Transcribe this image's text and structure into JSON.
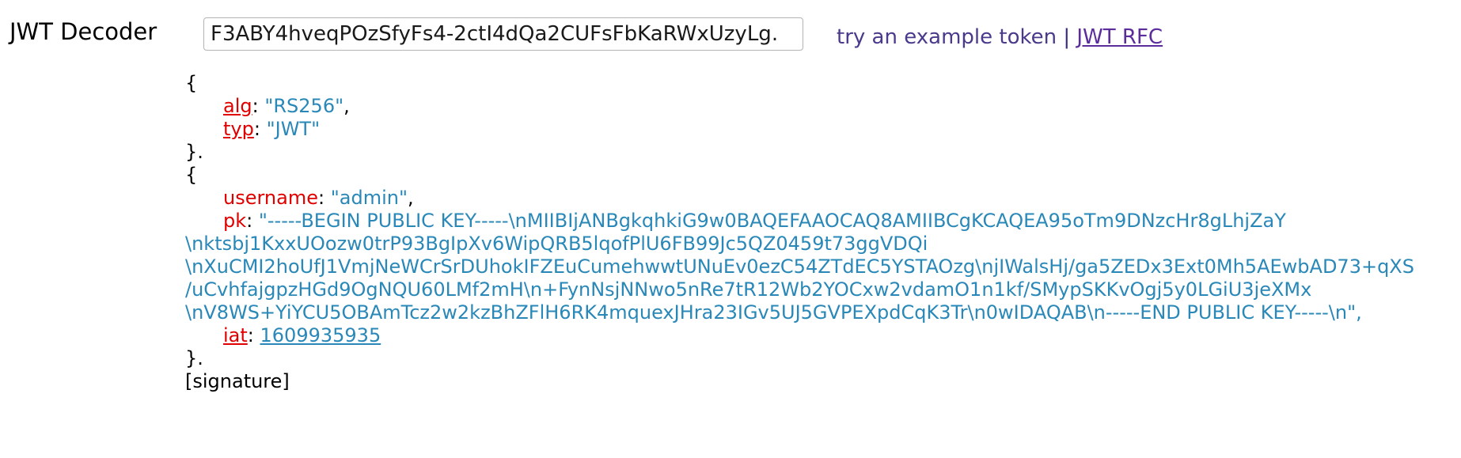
{
  "app": {
    "title": "JWT Decoder"
  },
  "token_input": {
    "value": ".F3ABY4hveqPOzSfyFs4-2ctI4dQa2CUFsFbKaRWxUzyLg"
  },
  "links": {
    "example": "try an example token",
    "separator": "|",
    "rfc": "JWT RFC"
  },
  "header": {
    "open": "{",
    "close": "}.",
    "alg": {
      "key": "alg",
      "value": "\"RS256\""
    },
    "typ": {
      "key": "typ",
      "value": "\"JWT\""
    }
  },
  "payload": {
    "open": "{",
    "close": "}.",
    "username": {
      "key": "username",
      "value": "\"admin\""
    },
    "pk": {
      "key": "pk",
      "lines": [
        "\"-----BEGIN PUBLIC KEY-----\\nMIIBIjANBgkqhkiG9w0BAQEFAAOCAQ8AMIIBCgKCAQEA95oTm9DNzcHr8gLhjZaY",
        "\\nktsbj1KxxUOozw0trP93BgIpXv6WipQRB5lqofPlU6FB99Jc5QZ0459t73ggVDQi",
        "\\nXuCMI2hoUfJ1VmjNeWCrSrDUhokIFZEuCumehwwtUNuEv0ezC54ZTdEC5YSTAOzg\\njIWalsHj/ga5ZEDx3Ext0Mh5AEwbAD73+qXS",
        "/uCvhfajgpzHGd9OgNQU60LMf2mH\\n+FynNsjNNwo5nRe7tR12Wb2YOCxw2vdamO1n1kf/SMypSKKvOgj5y0LGiU3jeXMx",
        "\\nV8WS+YiYCU5OBAmTcz2w2kzBhZFlH6RK4mquexJHra23IGv5UJ5GVPEXpdCqK3Tr\\n0wIDAQAB\\n-----END PUBLIC KEY-----\\n\","
      ]
    },
    "iat": {
      "key": "iat",
      "value": "1609935935"
    }
  },
  "signature": "[signature]"
}
